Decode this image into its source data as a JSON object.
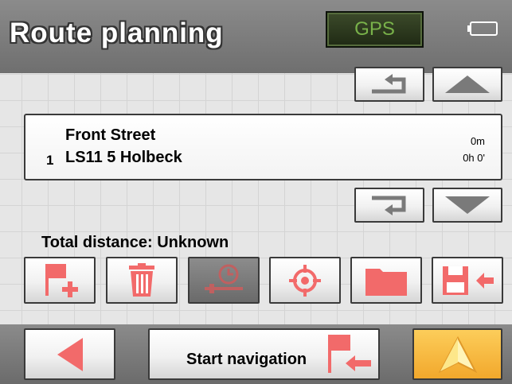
{
  "header": {
    "title": "Route planning",
    "gps_label": "GPS"
  },
  "route": {
    "items": [
      {
        "index": "1",
        "street": "Front Street",
        "city": "LS11 5 Holbeck",
        "distance": "0m",
        "time": "0h 0'"
      }
    ],
    "total_distance_label": "Total distance: Unknown"
  },
  "toolbar": {
    "icons": [
      "add-destination-icon",
      "delete-icon",
      "route-options-icon",
      "target-icon",
      "folder-icon",
      "save-route-icon"
    ]
  },
  "bottom": {
    "start_navigation_label": "Start navigation"
  },
  "colors": {
    "accent_red": "#f26a6a",
    "gps_green": "#79b24a",
    "nav_orange": "#f7b430"
  }
}
